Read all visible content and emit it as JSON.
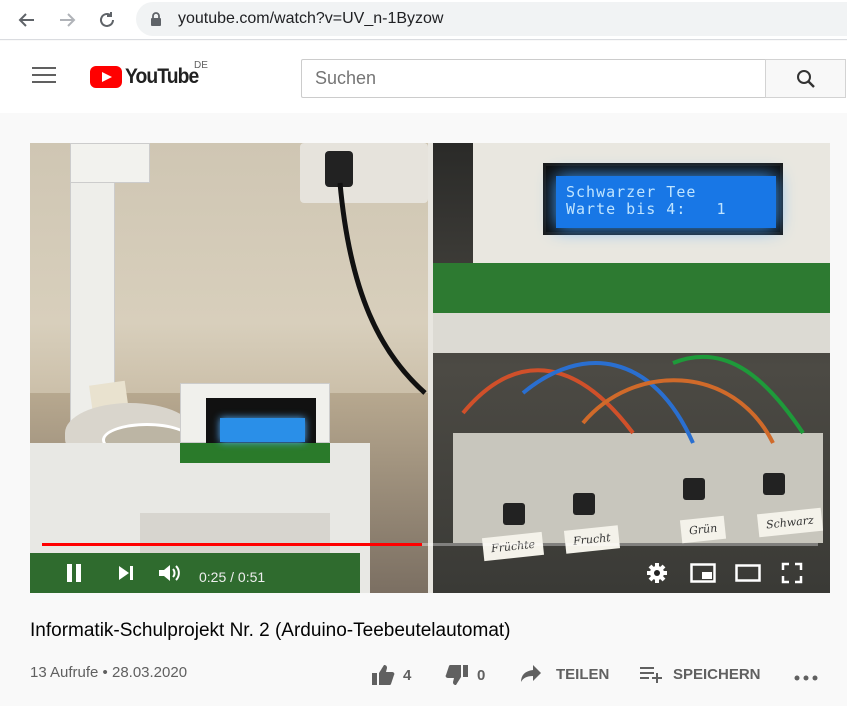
{
  "browser": {
    "url": "youtube.com/watch?v=UV_n-1Byzow"
  },
  "header": {
    "logo_text": "YouTube",
    "region": "DE",
    "search_placeholder": "Suchen"
  },
  "video": {
    "lcd_line1": "Schwarzer Tee",
    "lcd_line2": "Warte bis 4:   1",
    "labels": [
      "Früchte",
      "Frucht",
      "Grün",
      "Schwarz"
    ],
    "current_time": "0:25",
    "duration": "0:51",
    "time_display": "0:25 / 0:51",
    "progress": 0.49
  },
  "info": {
    "title": "Informatik-Schulprojekt Nr. 2 (Arduino-Teebeutelautomat)",
    "views_date": "13 Aufrufe • 28.03.2020",
    "likes": "4",
    "dislikes": "0",
    "share_label": "TEILEN",
    "save_label": "SPEICHERN"
  },
  "colors": {
    "accent": "#ff0000",
    "lcd": "#1877e6"
  }
}
